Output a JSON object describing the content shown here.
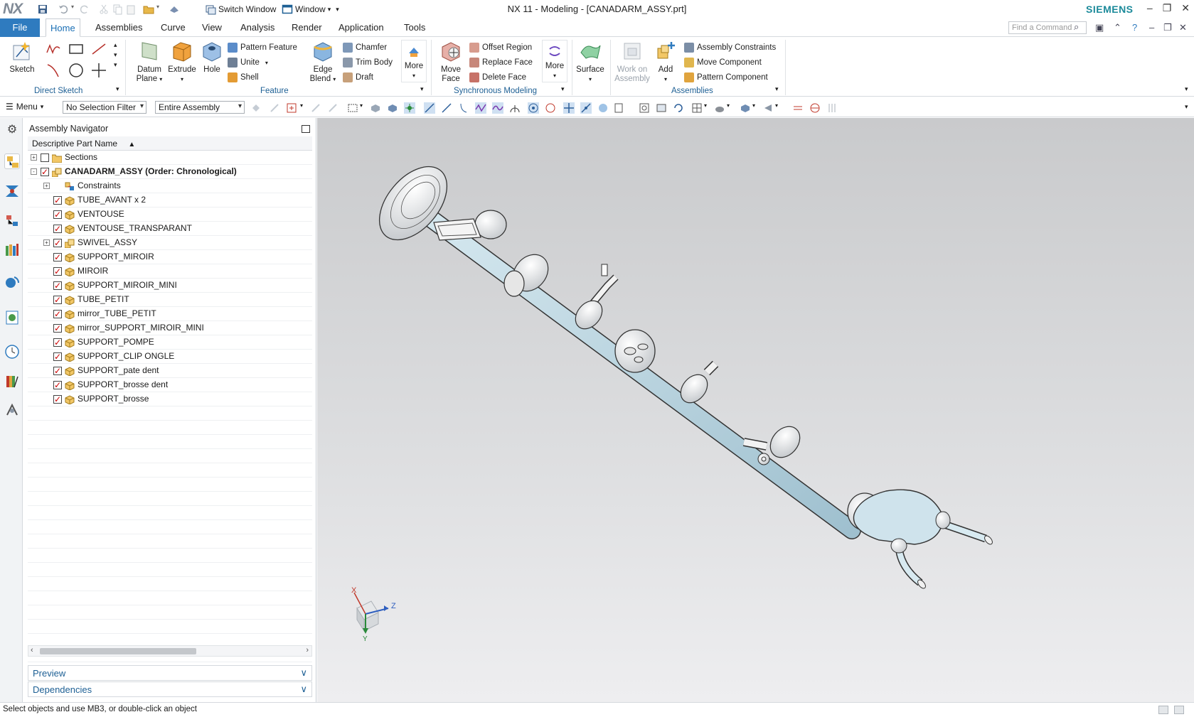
{
  "window": {
    "title": "NX 11 - Modeling - [CANADARM_ASSY.prt]",
    "logo": "NX",
    "brand": "SIEMENS",
    "switch_window": "Switch Window",
    "window_menu": "Window"
  },
  "tabs": {
    "file": "File",
    "items": [
      "Home",
      "Assemblies",
      "Curve",
      "View",
      "Analysis",
      "Render",
      "Application",
      "Tools"
    ],
    "active": "Home",
    "find_command_placeholder": "Find a Command"
  },
  "ribbon": {
    "direct_sketch": {
      "label": "Direct Sketch",
      "sketch": "Sketch"
    },
    "feature": {
      "label": "Feature",
      "datum_plane_1": "Datum",
      "datum_plane_2": "Plane",
      "extrude": "Extrude",
      "hole": "Hole",
      "pattern_feature": "Pattern Feature",
      "unite": "Unite",
      "shell": "Shell",
      "edge_blend_1": "Edge",
      "edge_blend_2": "Blend",
      "chamfer": "Chamfer",
      "trim_body": "Trim Body",
      "draft": "Draft",
      "more": "More"
    },
    "synchronous": {
      "label": "Synchronous Modeling",
      "move_face_1": "Move",
      "move_face_2": "Face",
      "offset_region": "Offset Region",
      "replace_face": "Replace Face",
      "delete_face": "Delete Face",
      "more": "More"
    },
    "surface": {
      "label": "Surface"
    },
    "assemblies": {
      "label": "Assemblies",
      "work_on_1": "Work on",
      "work_on_2": "Assembly",
      "add": "Add",
      "assembly_constraints": "Assembly Constraints",
      "move_component": "Move Component",
      "pattern_component": "Pattern Component"
    }
  },
  "selection_bar": {
    "menu": "Menu",
    "filter": "No Selection Filter",
    "scope": "Entire Assembly"
  },
  "navigator": {
    "title": "Assembly Navigator",
    "column_header": "Descriptive Part Name",
    "rows": [
      {
        "label": "Sections",
        "level": 0,
        "expander": "+",
        "checked": false,
        "icon": "folder",
        "bold": false
      },
      {
        "label": "CANADARM_ASSY (Order: Chronological)",
        "level": 0,
        "expander": "-",
        "checked": true,
        "icon": "assembly",
        "bold": true
      },
      {
        "label": "Constraints",
        "level": 1,
        "expander": "+",
        "checked": null,
        "icon": "constraints",
        "bold": false
      },
      {
        "label": "TUBE_AVANT x 2",
        "level": 1,
        "expander": "",
        "checked": true,
        "icon": "part",
        "bold": false
      },
      {
        "label": "VENTOUSE",
        "level": 1,
        "expander": "",
        "checked": true,
        "icon": "part",
        "bold": false
      },
      {
        "label": "VENTOUSE_TRANSPARANT",
        "level": 1,
        "expander": "",
        "checked": true,
        "icon": "part",
        "bold": false
      },
      {
        "label": "SWIVEL_ASSY",
        "level": 1,
        "expander": "+",
        "checked": true,
        "icon": "assembly",
        "bold": false
      },
      {
        "label": "SUPPORT_MIROIR",
        "level": 1,
        "expander": "",
        "checked": true,
        "icon": "part",
        "bold": false
      },
      {
        "label": "MIROIR",
        "level": 1,
        "expander": "",
        "checked": true,
        "icon": "part",
        "bold": false
      },
      {
        "label": "SUPPORT_MIROIR_MINI",
        "level": 1,
        "expander": "",
        "checked": true,
        "icon": "part",
        "bold": false
      },
      {
        "label": "TUBE_PETIT",
        "level": 1,
        "expander": "",
        "checked": true,
        "icon": "part",
        "bold": false
      },
      {
        "label": "mirror_TUBE_PETIT",
        "level": 1,
        "expander": "",
        "checked": true,
        "icon": "part",
        "bold": false
      },
      {
        "label": "mirror_SUPPORT_MIROIR_MINI",
        "level": 1,
        "expander": "",
        "checked": true,
        "icon": "part",
        "bold": false
      },
      {
        "label": "SUPPORT_POMPE",
        "level": 1,
        "expander": "",
        "checked": true,
        "icon": "part",
        "bold": false
      },
      {
        "label": "SUPPORT_CLIP ONGLE",
        "level": 1,
        "expander": "",
        "checked": true,
        "icon": "part",
        "bold": false
      },
      {
        "label": "SUPPORT_pate dent",
        "level": 1,
        "expander": "",
        "checked": true,
        "icon": "part",
        "bold": false
      },
      {
        "label": "SUPPORT_brosse dent",
        "level": 1,
        "expander": "",
        "checked": true,
        "icon": "part",
        "bold": false
      },
      {
        "label": "SUPPORT_brosse",
        "level": 1,
        "expander": "",
        "checked": true,
        "icon": "part",
        "bold": false
      }
    ],
    "preview": "Preview",
    "dependencies": "Dependencies"
  },
  "triad": {
    "x": "X",
    "y": "Y",
    "z": "Z"
  },
  "status": "Select objects and use MB3, or double-click an object",
  "colors": {
    "accent": "#2f7bbf",
    "brand": "#1b8a9a",
    "tube": "#bcd7e2",
    "check": "#cc0000"
  }
}
